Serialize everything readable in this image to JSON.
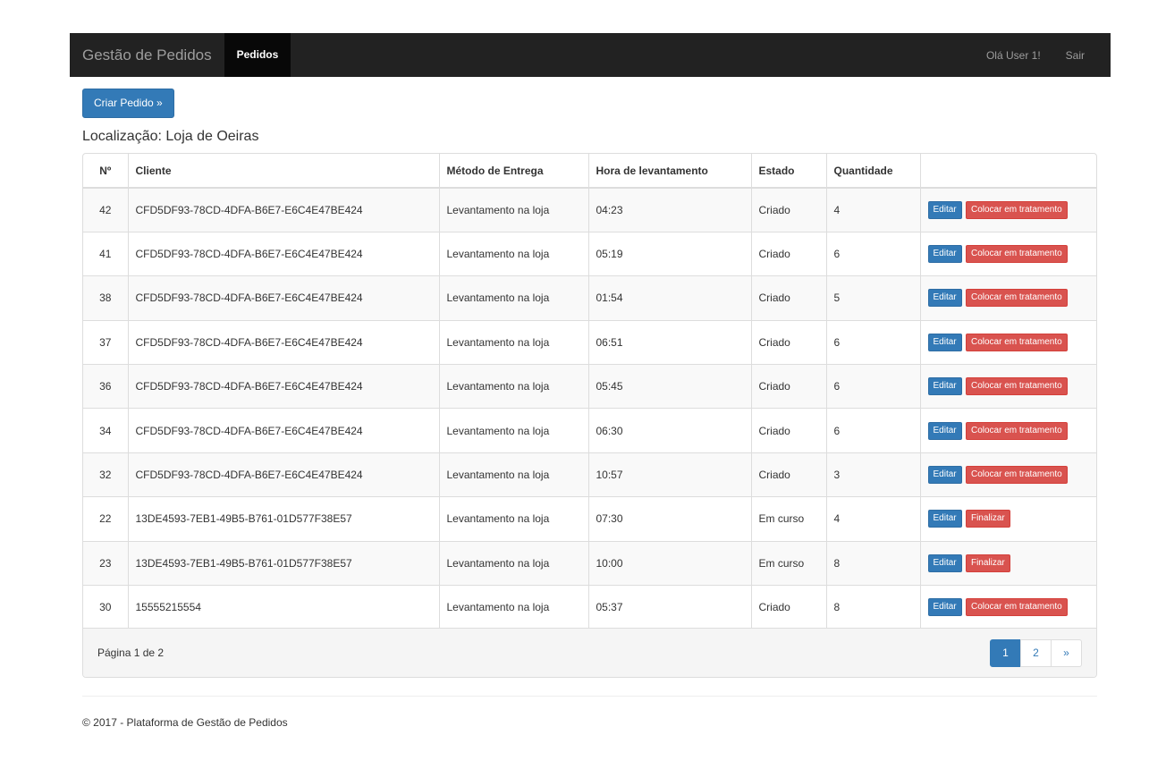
{
  "navbar": {
    "brand": "Gestão de Pedidos",
    "active_item": "Pedidos",
    "greeting": "Olá User 1!",
    "logout": "Sair"
  },
  "create_button": "Criar Pedido »",
  "location": "Localização: Loja de Oeiras",
  "table": {
    "headers": [
      "Nº",
      "Cliente",
      "Método de Entrega",
      "Hora de levantamento",
      "Estado",
      "Quantidade",
      ""
    ],
    "edit_label": "Editar",
    "rows": [
      {
        "n": "42",
        "cliente": "CFD5DF93-78CD-4DFA-B6E7-E6C4E47BE424",
        "metodo": "Levantamento na loja",
        "hora": "04:23",
        "estado": "Criado",
        "quantidade": "4",
        "action": "Colocar em tratamento"
      },
      {
        "n": "41",
        "cliente": "CFD5DF93-78CD-4DFA-B6E7-E6C4E47BE424",
        "metodo": "Levantamento na loja",
        "hora": "05:19",
        "estado": "Criado",
        "quantidade": "6",
        "action": "Colocar em tratamento"
      },
      {
        "n": "38",
        "cliente": "CFD5DF93-78CD-4DFA-B6E7-E6C4E47BE424",
        "metodo": "Levantamento na loja",
        "hora": "01:54",
        "estado": "Criado",
        "quantidade": "5",
        "action": "Colocar em tratamento"
      },
      {
        "n": "37",
        "cliente": "CFD5DF93-78CD-4DFA-B6E7-E6C4E47BE424",
        "metodo": "Levantamento na loja",
        "hora": "06:51",
        "estado": "Criado",
        "quantidade": "6",
        "action": "Colocar em tratamento"
      },
      {
        "n": "36",
        "cliente": "CFD5DF93-78CD-4DFA-B6E7-E6C4E47BE424",
        "metodo": "Levantamento na loja",
        "hora": "05:45",
        "estado": "Criado",
        "quantidade": "6",
        "action": "Colocar em tratamento"
      },
      {
        "n": "34",
        "cliente": "CFD5DF93-78CD-4DFA-B6E7-E6C4E47BE424",
        "metodo": "Levantamento na loja",
        "hora": "06:30",
        "estado": "Criado",
        "quantidade": "6",
        "action": "Colocar em tratamento"
      },
      {
        "n": "32",
        "cliente": "CFD5DF93-78CD-4DFA-B6E7-E6C4E47BE424",
        "metodo": "Levantamento na loja",
        "hora": "10:57",
        "estado": "Criado",
        "quantidade": "3",
        "action": "Colocar em tratamento"
      },
      {
        "n": "22",
        "cliente": "13DE4593-7EB1-49B5-B761-01D577F38E57",
        "metodo": "Levantamento na loja",
        "hora": "07:30",
        "estado": "Em curso",
        "quantidade": "4",
        "action": "Finalizar"
      },
      {
        "n": "23",
        "cliente": "13DE4593-7EB1-49B5-B761-01D577F38E57",
        "metodo": "Levantamento na loja",
        "hora": "10:00",
        "estado": "Em curso",
        "quantidade": "8",
        "action": "Finalizar"
      },
      {
        "n": "30",
        "cliente": "15555215554",
        "metodo": "Levantamento na loja",
        "hora": "05:37",
        "estado": "Criado",
        "quantidade": "8",
        "action": "Colocar em tratamento"
      }
    ]
  },
  "pagination": {
    "info": "Página 1 de 2",
    "pages": [
      "1",
      "2"
    ],
    "next": "»"
  },
  "footer": "© 2017 - Plataforma de Gestão de Pedidos",
  "colors": {
    "navbar_bg": "#222222",
    "primary": "#337ab7",
    "danger": "#d9534f"
  }
}
